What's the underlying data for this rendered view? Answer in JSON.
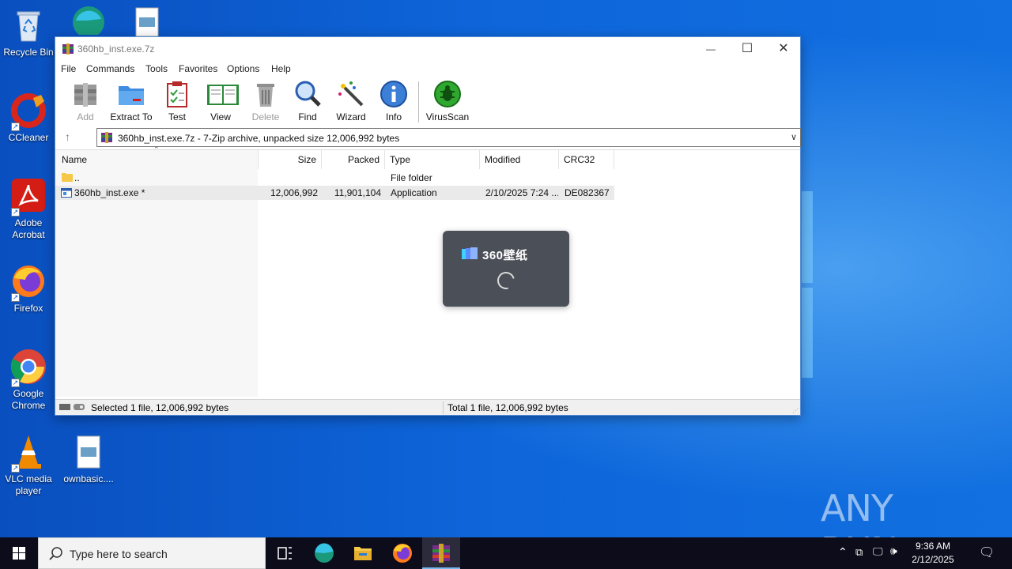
{
  "desktop": {
    "icons": [
      {
        "label": "Recycle Bin"
      },
      {
        "label": "CCleaner"
      },
      {
        "label": "Adobe Acrobat"
      },
      {
        "label": "Firefox"
      },
      {
        "label": "Google Chrome"
      },
      {
        "label": "VLC media player"
      },
      {
        "label": "ownbasic...."
      }
    ]
  },
  "window": {
    "title": "360hb_inst.exe.7z",
    "controls": {
      "minimize": "—",
      "maximize": "☐",
      "close": "✕"
    },
    "menu": [
      "File",
      "Commands",
      "Tools",
      "Favorites",
      "Options",
      "Help"
    ],
    "toolbar": [
      {
        "label": "Add",
        "enabled": false
      },
      {
        "label": "Extract To",
        "enabled": true
      },
      {
        "label": "Test",
        "enabled": true
      },
      {
        "label": "View",
        "enabled": true
      },
      {
        "label": "Delete",
        "enabled": false
      },
      {
        "label": "Find",
        "enabled": true
      },
      {
        "label": "Wizard",
        "enabled": true
      },
      {
        "label": "Info",
        "enabled": true
      },
      {
        "label": "VirusScan",
        "enabled": true
      }
    ],
    "address": "360hb_inst.exe.7z - 7-Zip archive, unpacked size 12,006,992 bytes",
    "columns": [
      "Name",
      "Size",
      "Packed",
      "Type",
      "Modified",
      "CRC32"
    ],
    "rows": [
      {
        "name": "..",
        "size": "",
        "packed": "",
        "type": "File folder",
        "modified": "",
        "crc": "",
        "selected": false
      },
      {
        "name": "360hb_inst.exe *",
        "size": "12,006,992",
        "packed": "11,901,104",
        "type": "Application",
        "modified": "2/10/2025 7:24 ...",
        "crc": "DE082367",
        "selected": true
      }
    ],
    "status": {
      "left": "Selected 1 file, 12,006,992 bytes",
      "right": "Total 1 file, 12,006,992 bytes"
    }
  },
  "splash": {
    "brand": "360壁纸"
  },
  "watermark": {
    "text": "ANY RUN"
  },
  "taskbar": {
    "search_placeholder": "Type here to search",
    "time": "9:36 AM",
    "date": "2/12/2025"
  }
}
